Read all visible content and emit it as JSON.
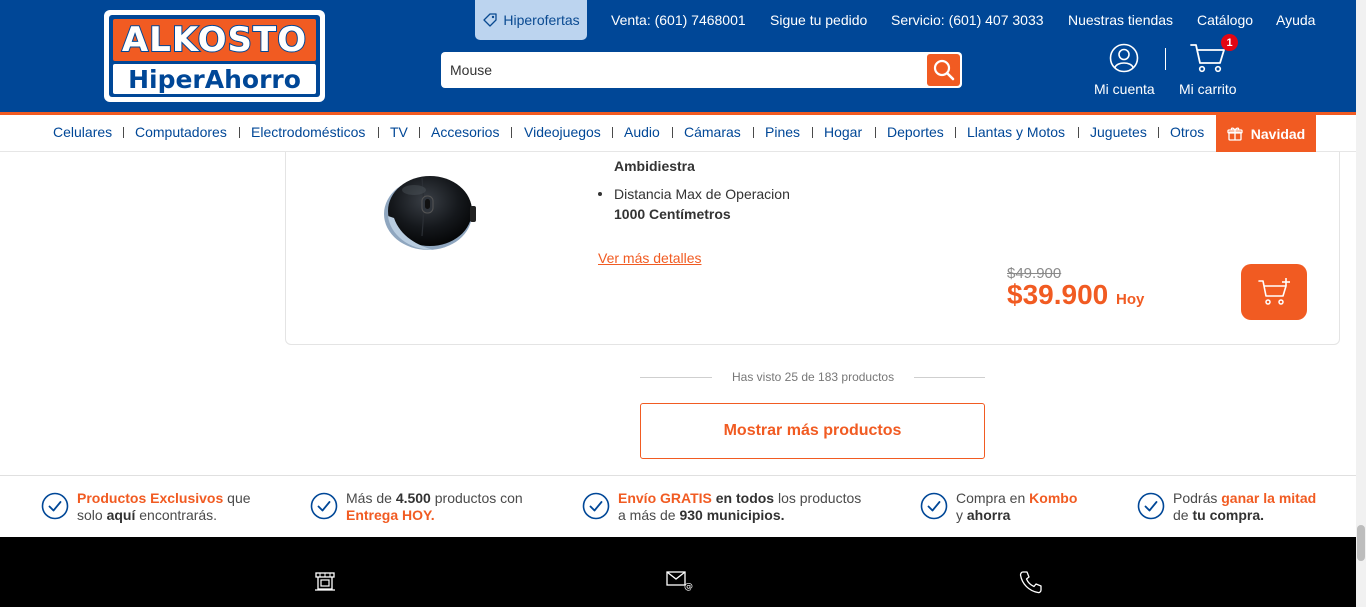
{
  "brand": {
    "logo_top": "ALKOSTO",
    "logo_bottom": "HiperAhorro",
    "colors": {
      "primary": "#004797",
      "accent": "#f15b22"
    }
  },
  "topnav": {
    "hiperofertas": "Hiperofertas",
    "links": [
      "Venta: (601) 7468001",
      "Sigue tu pedido",
      "Servicio: (601) 407 3033",
      "Nuestras tiendas",
      "Catálogo",
      "Ayuda"
    ]
  },
  "search": {
    "value": "Mouse",
    "icon": "search-icon"
  },
  "account": {
    "label": "Mi cuenta",
    "icon": "user-icon"
  },
  "cart": {
    "label": "Mi carrito",
    "count": "1",
    "icon": "cart-icon"
  },
  "categories": [
    "Celulares",
    "Computadores",
    "Electrodomésticos",
    "TV",
    "Accesorios",
    "Videojuegos",
    "Audio",
    "Cámaras",
    "Pines",
    "Hogar",
    "Deportes",
    "Llantas y Motos",
    "Juguetes",
    "Otros"
  ],
  "navidad": "Navidad",
  "product": {
    "specs": [
      {
        "value": "Ambidiestra"
      },
      {
        "label": "Distancia Max de Operacion",
        "value": "1000 Centímetros"
      }
    ],
    "details_link": "Ver más detalles",
    "old_price": "$49.900",
    "price": "$39.900",
    "price_suffix": "Hoy"
  },
  "pagination": {
    "seen_text": "Has visto 25 de 183 productos",
    "more_button": "Mostrar más productos"
  },
  "benefits": [
    {
      "parts": [
        [
          "o",
          "Productos Exclusivos"
        ],
        [
          "n",
          " que"
        ],
        [
          "br",
          ""
        ],
        [
          "n",
          "solo "
        ],
        [
          "b",
          "aquí"
        ],
        [
          "n",
          " encontrarás."
        ]
      ]
    },
    {
      "parts": [
        [
          "n",
          "Más de "
        ],
        [
          "b",
          "4.500"
        ],
        [
          "n",
          " productos con"
        ],
        [
          "br",
          ""
        ],
        [
          "o",
          "Entrega HOY."
        ]
      ]
    },
    {
      "parts": [
        [
          "o",
          "Envío GRATIS"
        ],
        [
          "b",
          " en todos"
        ],
        [
          "n",
          " los productos"
        ],
        [
          "br",
          ""
        ],
        [
          "n",
          "a más de "
        ],
        [
          "b",
          "930 municipios."
        ]
      ]
    },
    {
      "parts": [
        [
          "n",
          "Compra en "
        ],
        [
          "o",
          "Kombo"
        ],
        [
          "br",
          ""
        ],
        [
          "n",
          "y "
        ],
        [
          "b",
          "ahorra"
        ]
      ]
    },
    {
      "parts": [
        [
          "n",
          "Podrás "
        ],
        [
          "o",
          "ganar la mitad"
        ],
        [
          "br",
          ""
        ],
        [
          "n",
          "de "
        ],
        [
          "b",
          "tu compra."
        ]
      ]
    }
  ],
  "footer_icons": [
    "store-icon",
    "mail-icon",
    "phone-icon"
  ]
}
